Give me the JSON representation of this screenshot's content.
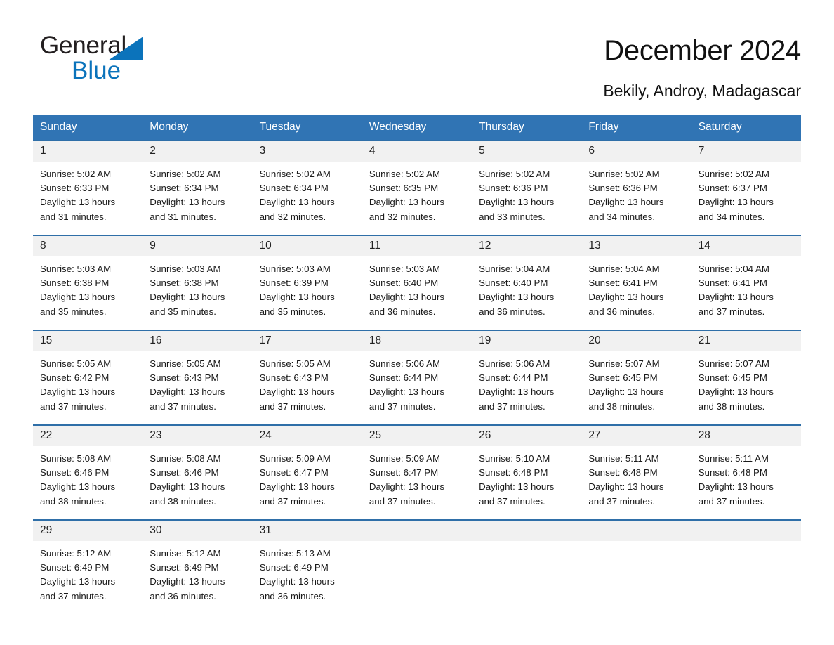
{
  "brand": {
    "name_part1": "General",
    "name_part2": "Blue",
    "triangle_color": "#0b73bb",
    "text_color": "#231f20"
  },
  "header": {
    "title": "December 2024",
    "location": "Bekily, Androy, Madagascar"
  },
  "theme": {
    "header_blue": "#3074b4",
    "row_divider_blue": "#2f6fa8",
    "daynum_band": "#f1f1f1"
  },
  "calendar": {
    "weekday_headers": [
      "Sunday",
      "Monday",
      "Tuesday",
      "Wednesday",
      "Thursday",
      "Friday",
      "Saturday"
    ],
    "weeks": [
      [
        {
          "day": "1",
          "sunrise": "Sunrise: 5:02 AM",
          "sunset": "Sunset: 6:33 PM",
          "daylight_line1": "Daylight: 13 hours",
          "daylight_line2": "and 31 minutes."
        },
        {
          "day": "2",
          "sunrise": "Sunrise: 5:02 AM",
          "sunset": "Sunset: 6:34 PM",
          "daylight_line1": "Daylight: 13 hours",
          "daylight_line2": "and 31 minutes."
        },
        {
          "day": "3",
          "sunrise": "Sunrise: 5:02 AM",
          "sunset": "Sunset: 6:34 PM",
          "daylight_line1": "Daylight: 13 hours",
          "daylight_line2": "and 32 minutes."
        },
        {
          "day": "4",
          "sunrise": "Sunrise: 5:02 AM",
          "sunset": "Sunset: 6:35 PM",
          "daylight_line1": "Daylight: 13 hours",
          "daylight_line2": "and 32 minutes."
        },
        {
          "day": "5",
          "sunrise": "Sunrise: 5:02 AM",
          "sunset": "Sunset: 6:36 PM",
          "daylight_line1": "Daylight: 13 hours",
          "daylight_line2": "and 33 minutes."
        },
        {
          "day": "6",
          "sunrise": "Sunrise: 5:02 AM",
          "sunset": "Sunset: 6:36 PM",
          "daylight_line1": "Daylight: 13 hours",
          "daylight_line2": "and 34 minutes."
        },
        {
          "day": "7",
          "sunrise": "Sunrise: 5:02 AM",
          "sunset": "Sunset: 6:37 PM",
          "daylight_line1": "Daylight: 13 hours",
          "daylight_line2": "and 34 minutes."
        }
      ],
      [
        {
          "day": "8",
          "sunrise": "Sunrise: 5:03 AM",
          "sunset": "Sunset: 6:38 PM",
          "daylight_line1": "Daylight: 13 hours",
          "daylight_line2": "and 35 minutes."
        },
        {
          "day": "9",
          "sunrise": "Sunrise: 5:03 AM",
          "sunset": "Sunset: 6:38 PM",
          "daylight_line1": "Daylight: 13 hours",
          "daylight_line2": "and 35 minutes."
        },
        {
          "day": "10",
          "sunrise": "Sunrise: 5:03 AM",
          "sunset": "Sunset: 6:39 PM",
          "daylight_line1": "Daylight: 13 hours",
          "daylight_line2": "and 35 minutes."
        },
        {
          "day": "11",
          "sunrise": "Sunrise: 5:03 AM",
          "sunset": "Sunset: 6:40 PM",
          "daylight_line1": "Daylight: 13 hours",
          "daylight_line2": "and 36 minutes."
        },
        {
          "day": "12",
          "sunrise": "Sunrise: 5:04 AM",
          "sunset": "Sunset: 6:40 PM",
          "daylight_line1": "Daylight: 13 hours",
          "daylight_line2": "and 36 minutes."
        },
        {
          "day": "13",
          "sunrise": "Sunrise: 5:04 AM",
          "sunset": "Sunset: 6:41 PM",
          "daylight_line1": "Daylight: 13 hours",
          "daylight_line2": "and 36 minutes."
        },
        {
          "day": "14",
          "sunrise": "Sunrise: 5:04 AM",
          "sunset": "Sunset: 6:41 PM",
          "daylight_line1": "Daylight: 13 hours",
          "daylight_line2": "and 37 minutes."
        }
      ],
      [
        {
          "day": "15",
          "sunrise": "Sunrise: 5:05 AM",
          "sunset": "Sunset: 6:42 PM",
          "daylight_line1": "Daylight: 13 hours",
          "daylight_line2": "and 37 minutes."
        },
        {
          "day": "16",
          "sunrise": "Sunrise: 5:05 AM",
          "sunset": "Sunset: 6:43 PM",
          "daylight_line1": "Daylight: 13 hours",
          "daylight_line2": "and 37 minutes."
        },
        {
          "day": "17",
          "sunrise": "Sunrise: 5:05 AM",
          "sunset": "Sunset: 6:43 PM",
          "daylight_line1": "Daylight: 13 hours",
          "daylight_line2": "and 37 minutes."
        },
        {
          "day": "18",
          "sunrise": "Sunrise: 5:06 AM",
          "sunset": "Sunset: 6:44 PM",
          "daylight_line1": "Daylight: 13 hours",
          "daylight_line2": "and 37 minutes."
        },
        {
          "day": "19",
          "sunrise": "Sunrise: 5:06 AM",
          "sunset": "Sunset: 6:44 PM",
          "daylight_line1": "Daylight: 13 hours",
          "daylight_line2": "and 37 minutes."
        },
        {
          "day": "20",
          "sunrise": "Sunrise: 5:07 AM",
          "sunset": "Sunset: 6:45 PM",
          "daylight_line1": "Daylight: 13 hours",
          "daylight_line2": "and 38 minutes."
        },
        {
          "day": "21",
          "sunrise": "Sunrise: 5:07 AM",
          "sunset": "Sunset: 6:45 PM",
          "daylight_line1": "Daylight: 13 hours",
          "daylight_line2": "and 38 minutes."
        }
      ],
      [
        {
          "day": "22",
          "sunrise": "Sunrise: 5:08 AM",
          "sunset": "Sunset: 6:46 PM",
          "daylight_line1": "Daylight: 13 hours",
          "daylight_line2": "and 38 minutes."
        },
        {
          "day": "23",
          "sunrise": "Sunrise: 5:08 AM",
          "sunset": "Sunset: 6:46 PM",
          "daylight_line1": "Daylight: 13 hours",
          "daylight_line2": "and 38 minutes."
        },
        {
          "day": "24",
          "sunrise": "Sunrise: 5:09 AM",
          "sunset": "Sunset: 6:47 PM",
          "daylight_line1": "Daylight: 13 hours",
          "daylight_line2": "and 37 minutes."
        },
        {
          "day": "25",
          "sunrise": "Sunrise: 5:09 AM",
          "sunset": "Sunset: 6:47 PM",
          "daylight_line1": "Daylight: 13 hours",
          "daylight_line2": "and 37 minutes."
        },
        {
          "day": "26",
          "sunrise": "Sunrise: 5:10 AM",
          "sunset": "Sunset: 6:48 PM",
          "daylight_line1": "Daylight: 13 hours",
          "daylight_line2": "and 37 minutes."
        },
        {
          "day": "27",
          "sunrise": "Sunrise: 5:11 AM",
          "sunset": "Sunset: 6:48 PM",
          "daylight_line1": "Daylight: 13 hours",
          "daylight_line2": "and 37 minutes."
        },
        {
          "day": "28",
          "sunrise": "Sunrise: 5:11 AM",
          "sunset": "Sunset: 6:48 PM",
          "daylight_line1": "Daylight: 13 hours",
          "daylight_line2": "and 37 minutes."
        }
      ],
      [
        {
          "day": "29",
          "sunrise": "Sunrise: 5:12 AM",
          "sunset": "Sunset: 6:49 PM",
          "daylight_line1": "Daylight: 13 hours",
          "daylight_line2": "and 37 minutes."
        },
        {
          "day": "30",
          "sunrise": "Sunrise: 5:12 AM",
          "sunset": "Sunset: 6:49 PM",
          "daylight_line1": "Daylight: 13 hours",
          "daylight_line2": "and 36 minutes."
        },
        {
          "day": "31",
          "sunrise": "Sunrise: 5:13 AM",
          "sunset": "Sunset: 6:49 PM",
          "daylight_line1": "Daylight: 13 hours",
          "daylight_line2": "and 36 minutes."
        },
        {
          "day": "",
          "sunrise": "",
          "sunset": "",
          "daylight_line1": "",
          "daylight_line2": ""
        },
        {
          "day": "",
          "sunrise": "",
          "sunset": "",
          "daylight_line1": "",
          "daylight_line2": ""
        },
        {
          "day": "",
          "sunrise": "",
          "sunset": "",
          "daylight_line1": "",
          "daylight_line2": ""
        },
        {
          "day": "",
          "sunrise": "",
          "sunset": "",
          "daylight_line1": "",
          "daylight_line2": ""
        }
      ]
    ]
  }
}
